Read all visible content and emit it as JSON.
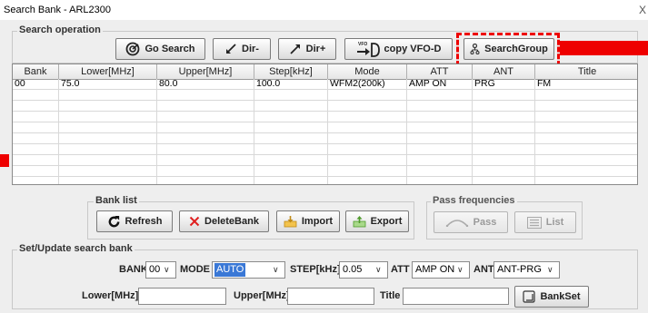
{
  "window": {
    "title": "Search Bank - ARL2300",
    "close": "X"
  },
  "search_operation": {
    "legend": "Search operation",
    "go_search": "Go Search",
    "dir_minus": "Dir-",
    "dir_plus": "Dir+",
    "copy_vfo": "copy VFO-D",
    "vfo_tag": "VFO",
    "search_group": "SearchGroup"
  },
  "table": {
    "columns": [
      "Bank",
      "Lower[MHz]",
      "Upper[MHz]",
      "Step[kHz]",
      "Mode",
      "ATT",
      "ANT",
      "Title"
    ],
    "rows": [
      {
        "bank": "00",
        "lower": "75.0",
        "upper": "80.0",
        "step": "100.0",
        "mode": "WFM2(200k)",
        "att": "AMP ON",
        "ant": "PRG",
        "title": "FM"
      }
    ]
  },
  "bank_list": {
    "legend": "Bank list",
    "refresh": "Refresh",
    "delete": "DeleteBank",
    "import": "Import",
    "export": "Export"
  },
  "pass_frequencies": {
    "legend": "Pass frequencies",
    "pass": "Pass",
    "list": "List"
  },
  "set_update": {
    "legend": "Set/Update search bank",
    "bank_label": "BANK",
    "bank_value": "00",
    "mode_label": "MODE",
    "mode_value": "AUTO",
    "step_label": "STEP[kHz]",
    "step_value": "0.05",
    "att_label": "ATT",
    "att_value": "AMP ON",
    "ant_label": "ANT",
    "ant_value": "ANT-PRG",
    "lower_label": "Lower[MHz]",
    "lower_value": "",
    "upper_label": "Upper[MHz]",
    "upper_value": "",
    "title_label": "Title",
    "title_value": "",
    "bankset": "BankSet"
  },
  "colors": {
    "highlight": "#ee0000",
    "selection": "#3a78d6"
  }
}
